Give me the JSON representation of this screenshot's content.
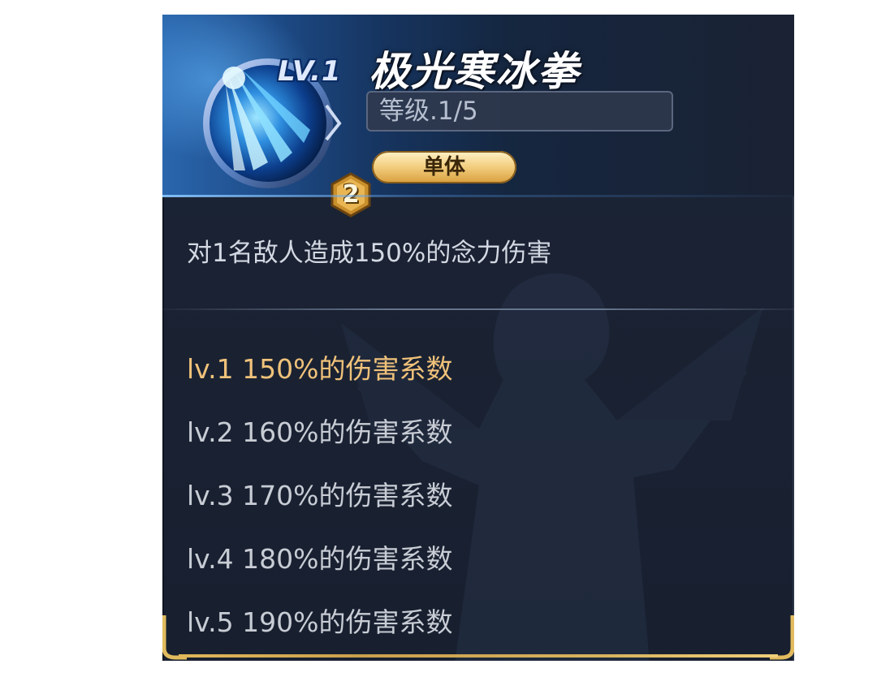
{
  "skill": {
    "lv_badge": "LV.1",
    "icon": "ice-fist-skill-icon",
    "count_badge": "2",
    "name": "极光寒冰拳",
    "level": "等级.1/5",
    "target": "单体",
    "description": "对1名敌人造成150%的念力伤害"
  },
  "levels": [
    {
      "text": "lv.1 150%的伤害系数",
      "active": true
    },
    {
      "text": "lv.2 160%的伤害系数",
      "active": false
    },
    {
      "text": "lv.3 170%的伤害系数",
      "active": false
    },
    {
      "text": "lv.4 180%的伤害系数",
      "active": false
    },
    {
      "text": "lv.5 190%的伤害系数",
      "active": false
    }
  ],
  "colors": {
    "panel_bg": "#1a2233",
    "active_level": "#f0c27a",
    "inactive_level": "#c8ccd4",
    "pill_gold": "#f2cd7d"
  }
}
